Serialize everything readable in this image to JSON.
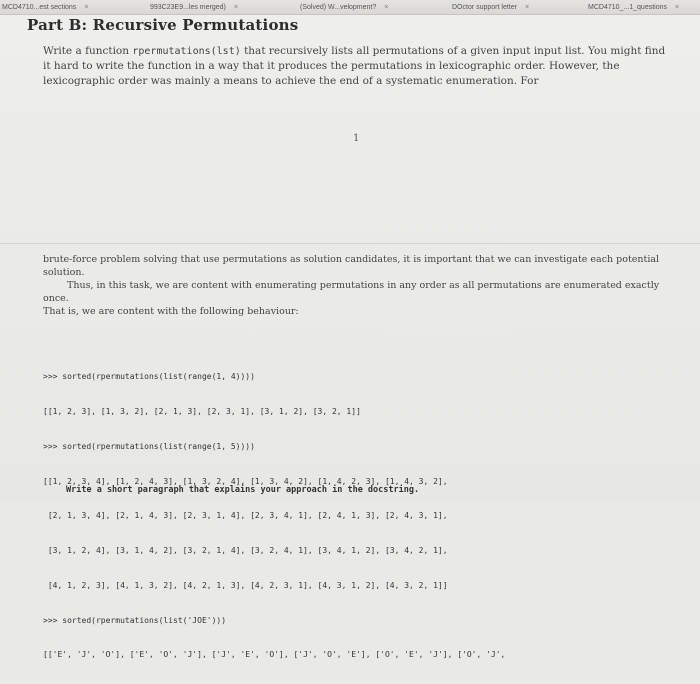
{
  "browser": {
    "tabs": [
      {
        "label": "MCD4710...est sections"
      },
      {
        "label": "993C23E9...les merged)"
      },
      {
        "label": "(Solved) W...velopment?"
      },
      {
        "label": "DOctor support letter"
      },
      {
        "label": "MCD4710_...1_questions"
      }
    ],
    "close_glyph": "×"
  },
  "document": {
    "title": "Part B: Recursive Permutations",
    "para1_pre": "Write a function ",
    "para1_code": "rpermutations(lst)",
    "para1_post": " that recursively lists all permutations of a given input input list. You might find it hard to write the function in a way that it produces the permutations in lexicographic order. However, the lexicographic order was mainly a means to achieve the end of a systematic enumeration. For",
    "page_number": "1",
    "para2_line1": "brute-force problem solving that use permutations as solution candidates, it is important that we can investigate each potential solution.",
    "para2_line2": "Thus, in this task, we are content with enumerating permutations in any order as all permutations are enumerated exactly once.",
    "para2_line3": "That is, we are content with the following behaviour:",
    "code_lines": [
      ">>> sorted(rpermutations(list(range(1, 4))))",
      "[[1, 2, 3], [1, 3, 2], [2, 1, 3], [2, 3, 1], [3, 1, 2], [3, 2, 1]]",
      ">>> sorted(rpermutations(list(range(1, 5))))",
      "[[1, 2, 3, 4], [1, 2, 4, 3], [1, 3, 2, 4], [1, 3, 4, 2], [1, 4, 2, 3], [1, 4, 3, 2],",
      " [2, 1, 3, 4], [2, 1, 4, 3], [2, 3, 1, 4], [2, 3, 4, 1], [2, 4, 1, 3], [2, 4, 3, 1],",
      " [3, 1, 2, 4], [3, 1, 4, 2], [3, 2, 1, 4], [3, 2, 4, 1], [3, 4, 1, 2], [3, 4, 2, 1],",
      " [4, 1, 2, 3], [4, 1, 3, 2], [4, 2, 1, 3], [4, 2, 3, 1], [4, 3, 1, 2], [4, 3, 2, 1]]",
      ">>> sorted(rpermutations(list('JOE')))",
      "[['E', 'J', 'O'], ['E', 'O', 'J'], ['J', 'E', 'O'], ['J', 'O', 'E'], ['O', 'E', 'J'], ['O', 'J',"
    ],
    "final_line": "Write a short paragraph that explains your approach in the docstring."
  }
}
